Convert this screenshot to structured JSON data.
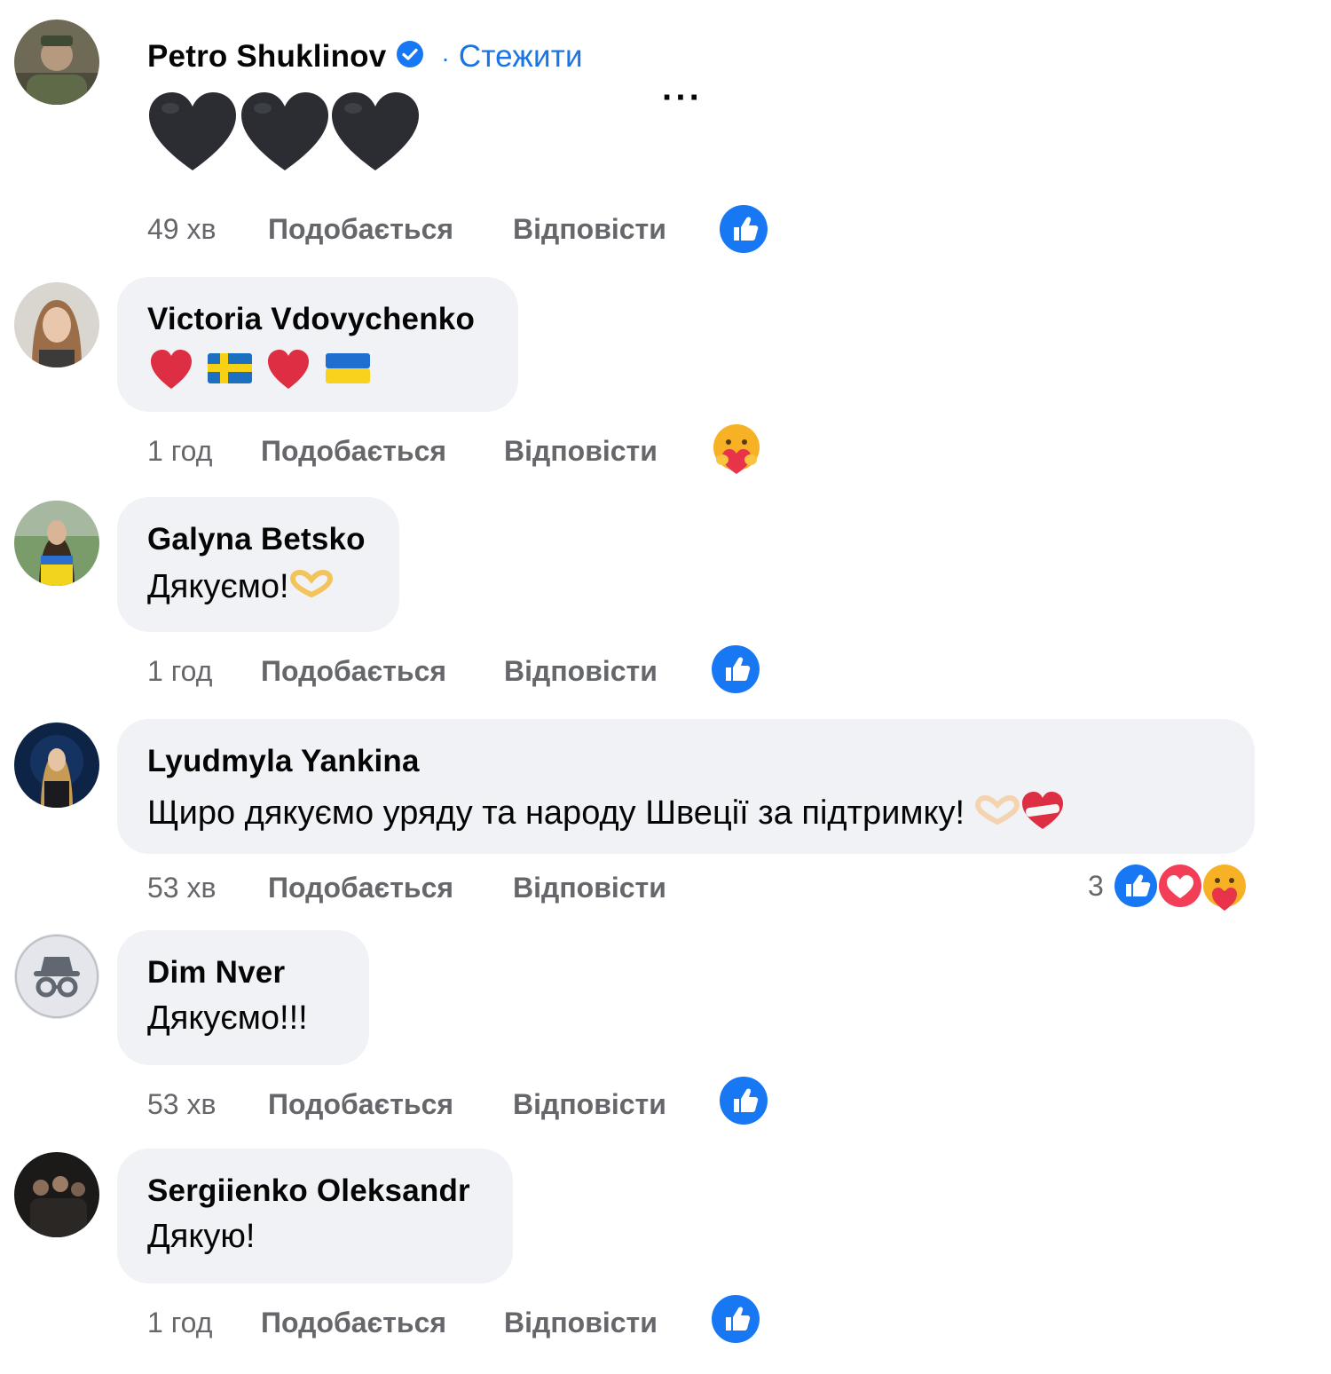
{
  "comments": [
    {
      "author": "Petro Shuklinov",
      "verified": true,
      "follow_label": "Стежити",
      "follow_separator": "·",
      "text": "",
      "emojis": [
        "black-heart",
        "black-heart",
        "black-heart"
      ],
      "time": "49 хв",
      "like_label": "Подобається",
      "reply_label": "Відповісти",
      "reaction": "like"
    },
    {
      "author": "Victoria Vdovychenko",
      "text": "",
      "emojis": [
        "red-heart",
        "sweden-flag",
        "red-heart",
        "ukraine-flag"
      ],
      "time": "1 год",
      "like_label": "Подобається",
      "reply_label": "Відповісти",
      "reaction": "care"
    },
    {
      "author": "Galyna Betsko",
      "text": "Дякуємо!",
      "emojis": [
        "heart-hands"
      ],
      "time": "1 год",
      "like_label": "Подобається",
      "reply_label": "Відповісти",
      "reaction": "like"
    },
    {
      "author": "Lyudmyla Yankina",
      "text": "Щиро дякуємо уряду та народу Швеції за підтримку!",
      "emojis": [
        "heart-hands",
        "heart-with-bandage"
      ],
      "time": "53 хв",
      "like_label": "Подобається",
      "reply_label": "Відповісти",
      "reaction_count": "3",
      "reactions": [
        "like",
        "love",
        "care"
      ]
    },
    {
      "author": "Dim Nver",
      "text": "Дякуємо!!!",
      "time": "53 хв",
      "like_label": "Подобається",
      "reply_label": "Відповісти",
      "reaction": "like"
    },
    {
      "author": "Sergiienko Oleksandr",
      "text": "Дякую!",
      "time": "1 год",
      "like_label": "Подобається",
      "reply_label": "Відповісти",
      "reaction": "like"
    }
  ],
  "more_options_label": "···",
  "colors": {
    "bubble": "#f0f2f5",
    "meta_text": "#65676b",
    "link_blue": "#1b74e4",
    "like_blue": "#1877f2"
  }
}
